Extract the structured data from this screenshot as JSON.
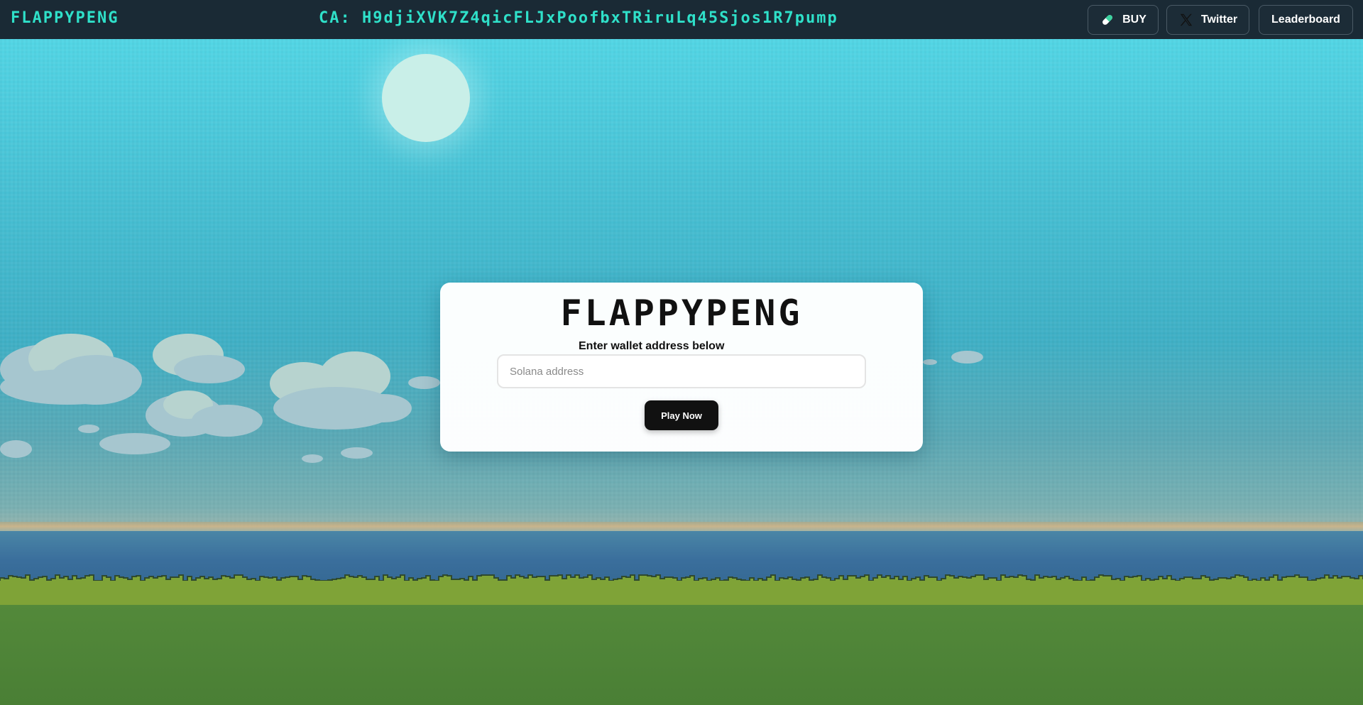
{
  "header": {
    "brand": "FLAPPYPENG",
    "contract": "CA: H9djiXVK7Z4qicFLJxPoofbxTRiruLq45Sjos1R7pump",
    "buttons": {
      "buy_label": "BUY",
      "buy_icon": "pill-icon",
      "twitter_label": "Twitter",
      "twitter_icon": "x-logo-icon",
      "leaderboard_label": "Leaderboard"
    }
  },
  "card": {
    "title": "FLAPPYPENG",
    "label": "Enter wallet address below",
    "input_placeholder": "Solana address",
    "input_value": "",
    "play_label": "Play Now"
  },
  "colors": {
    "accent": "#2fe0c9",
    "header_bg": "#1a2a35",
    "play_button": "#111111"
  }
}
